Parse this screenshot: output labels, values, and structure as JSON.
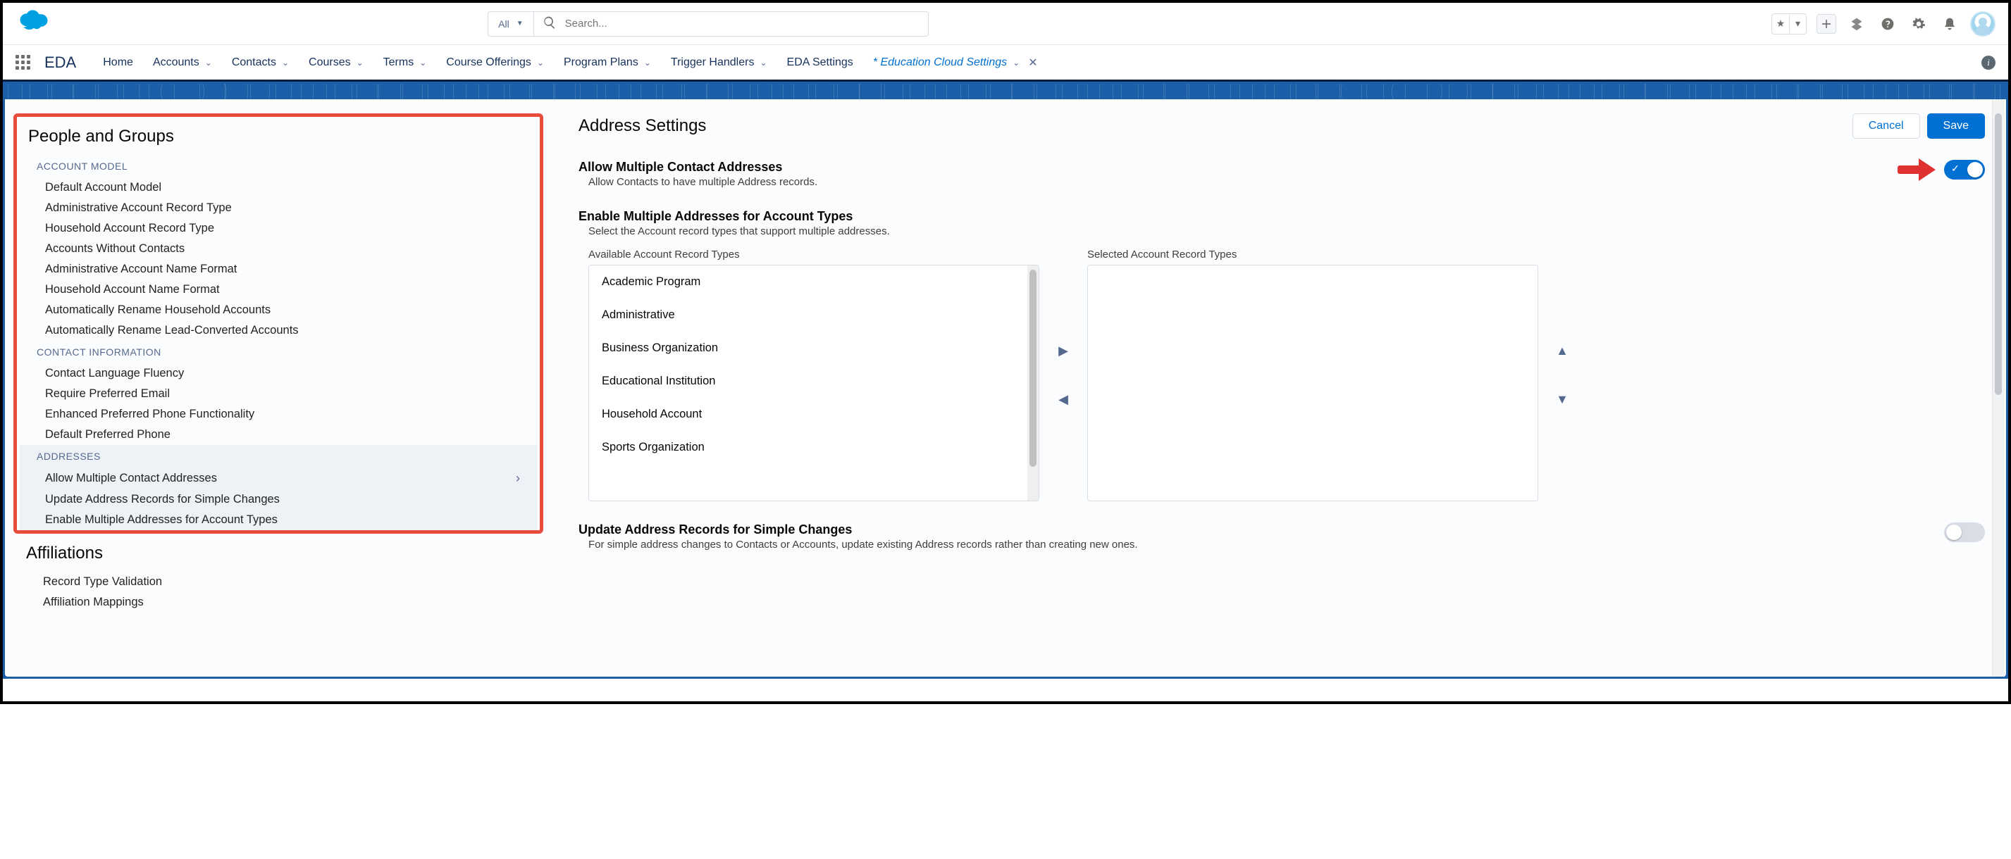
{
  "header": {
    "search_scope": "All",
    "search_placeholder": "Search..."
  },
  "app": {
    "name": "EDA"
  },
  "nav": {
    "items": [
      {
        "label": "Home",
        "dropdown": false
      },
      {
        "label": "Accounts",
        "dropdown": true
      },
      {
        "label": "Contacts",
        "dropdown": true
      },
      {
        "label": "Courses",
        "dropdown": true
      },
      {
        "label": "Terms",
        "dropdown": true
      },
      {
        "label": "Course Offerings",
        "dropdown": true
      },
      {
        "label": "Program Plans",
        "dropdown": true
      },
      {
        "label": "Trigger Handlers",
        "dropdown": true
      },
      {
        "label": "EDA Settings",
        "dropdown": false
      },
      {
        "label": "* Education Cloud Settings",
        "dropdown": true,
        "italic": true,
        "closable": true
      }
    ]
  },
  "sidebar": {
    "title": "People and Groups",
    "sections": [
      {
        "label": "ACCOUNT MODEL",
        "items": [
          "Default Account Model",
          "Administrative Account Record Type",
          "Household Account Record Type",
          "Accounts Without Contacts",
          "Administrative Account Name Format",
          "Household Account Name Format",
          "Automatically Rename Household Accounts",
          "Automatically Rename Lead-Converted Accounts"
        ]
      },
      {
        "label": "CONTACT INFORMATION",
        "items": [
          "Contact Language Fluency",
          "Require Preferred Email",
          "Enhanced Preferred Phone Functionality",
          "Default Preferred Phone"
        ]
      },
      {
        "label": "ADDRESSES",
        "active": true,
        "items": [
          "Allow Multiple Contact Addresses",
          "Update Address Records for Simple Changes",
          "Enable Multiple Addresses for Account Types"
        ]
      }
    ],
    "after": {
      "title": "Affiliations",
      "items": [
        "Record Type Validation",
        "Affiliation Mappings"
      ]
    }
  },
  "panel": {
    "title": "Address Settings",
    "cancel": "Cancel",
    "save": "Save",
    "allow_multi": {
      "title": "Allow Multiple Contact Addresses",
      "desc": "Allow Contacts to have multiple Address records.",
      "on": true
    },
    "enable_types": {
      "title": "Enable Multiple Addresses for Account Types",
      "desc": "Select the Account record types that support multiple addresses.",
      "available_label": "Available Account Record Types",
      "selected_label": "Selected Account Record Types",
      "available": [
        "Academic Program",
        "Administrative",
        "Business Organization",
        "Educational Institution",
        "Household Account",
        "Sports Organization"
      ]
    },
    "update_simple": {
      "title": "Update Address Records for Simple Changes",
      "desc": "For simple address changes to Contacts or Accounts, update existing Address records rather than creating new ones.",
      "on": false
    }
  }
}
